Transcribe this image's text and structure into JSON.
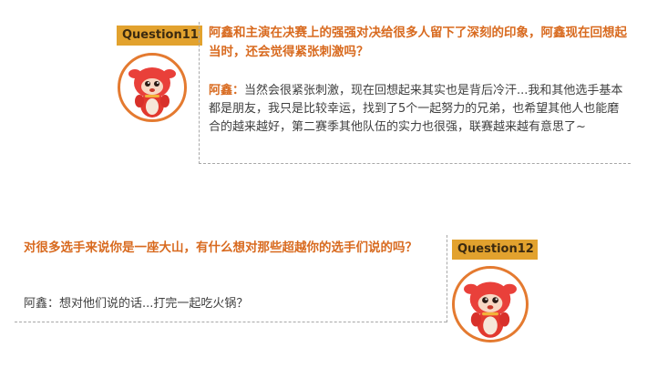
{
  "q11": {
    "badge": "Question11",
    "question": "阿鑫和主演在决赛上的强强对决给很多人留下了深刻的印象，阿鑫现在回想起当时，还会觉得紧张刺激吗？",
    "speaker": "阿鑫：",
    "answer": "当然会很紧张刺激，现在回想起来其实也是背后冷汗...我和其他选手基本都是朋友，我只是比较幸运，找到了5个一起努力的兄弟，也希望其他人也能磨合的越来越好，第二赛季其他队伍的实力也很强，联赛越来越有意思了~"
  },
  "q12": {
    "badge": "Question12",
    "question": "对很多选手来说你是一座大山，有什么想对那些超越你的选手们说的吗？",
    "speaker": "阿鑫：",
    "answer": "想对他们说的话...打完一起吃火锅？"
  },
  "colors": {
    "badge": "#e2a22e",
    "question_text": "#d86a1f",
    "avatar_ring": "#e47a30",
    "mascot": "#e2392f"
  },
  "icons": {
    "avatar": "red-mascot-avatar-icon"
  }
}
